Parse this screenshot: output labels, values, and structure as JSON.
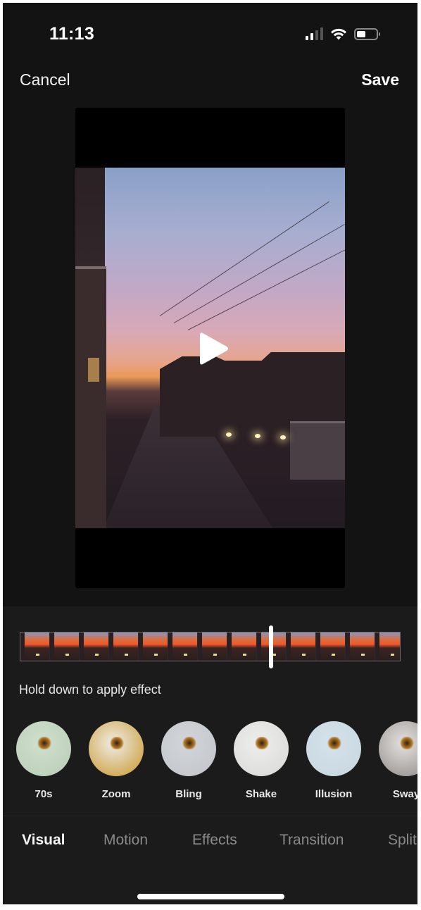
{
  "status_bar": {
    "time": "11:13",
    "signal_bars_total": 4,
    "signal_bars_active": 2,
    "wifi_icon": "wifi-icon",
    "battery_level": 0.45
  },
  "nav": {
    "cancel_label": "Cancel",
    "save_label": "Save"
  },
  "preview": {
    "play_icon": "play-icon"
  },
  "timeline": {
    "thumbnail_count": 13,
    "playhead_position": 0.66
  },
  "hint": "Hold down to apply effect",
  "effects": [
    {
      "label": "70s",
      "colors": [
        "#cfe0cc",
        "#b9cdb7"
      ]
    },
    {
      "label": "Zoom",
      "colors": [
        "#efece6",
        "#c89628"
      ]
    },
    {
      "label": "Bling",
      "colors": [
        "#d2d6da",
        "#c1c5c9"
      ]
    },
    {
      "label": "Shake",
      "colors": [
        "#eeeeec",
        "#d8d8d6"
      ]
    },
    {
      "label": "Illusion",
      "colors": [
        "#d4e2ea",
        "#c7d6df"
      ]
    },
    {
      "label": "Sway",
      "colors": [
        "#e4e2e0",
        "#8c8784"
      ]
    }
  ],
  "tabs": [
    {
      "label": "Visual",
      "active": true
    },
    {
      "label": "Motion",
      "active": false
    },
    {
      "label": "Effects",
      "active": false
    },
    {
      "label": "Transition",
      "active": false
    },
    {
      "label": "Split",
      "active": false
    }
  ]
}
